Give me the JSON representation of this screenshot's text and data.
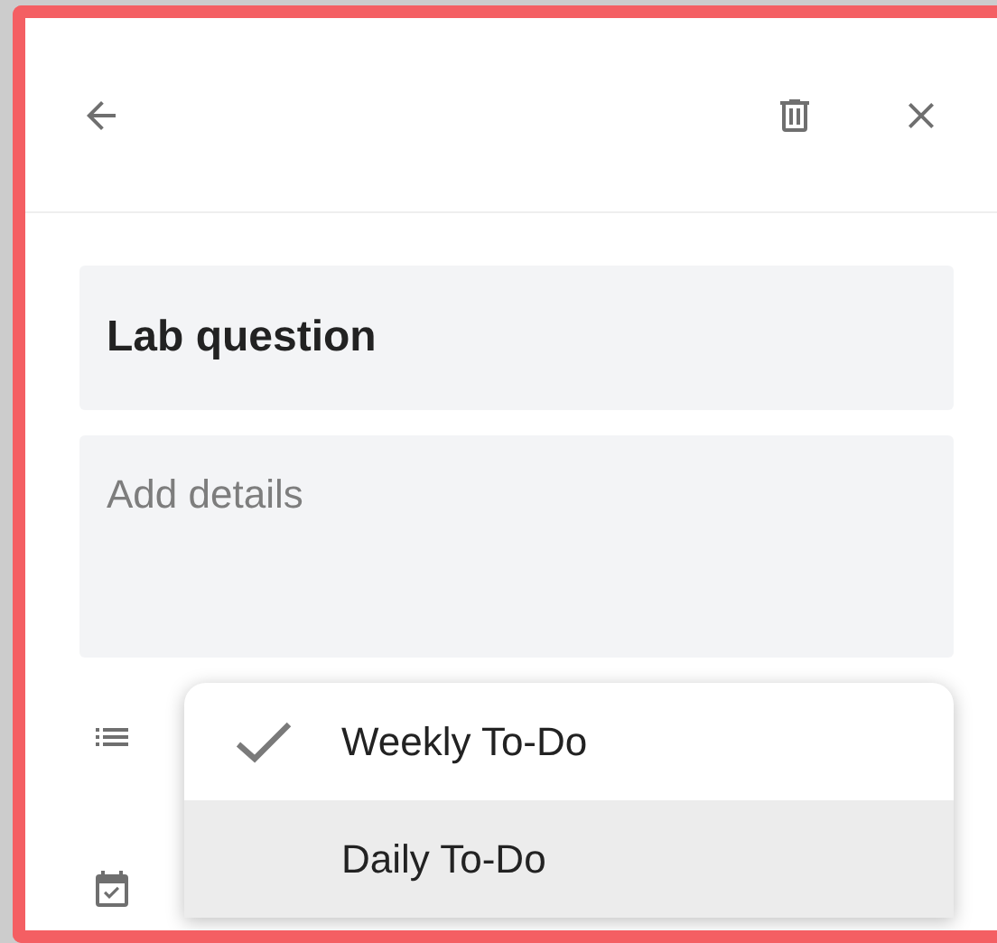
{
  "title_field": {
    "value": "Lab question"
  },
  "details_field": {
    "placeholder": "Add details"
  },
  "list_menu": {
    "items": [
      {
        "label": "Weekly To-Do",
        "checked": true,
        "highlighted": false
      },
      {
        "label": "Daily To-Do",
        "checked": false,
        "highlighted": true
      }
    ]
  }
}
